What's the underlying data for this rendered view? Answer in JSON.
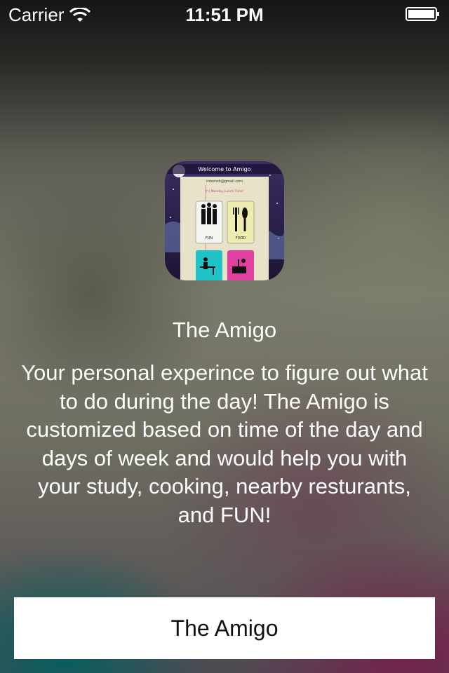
{
  "status_bar": {
    "carrier": "Carrier",
    "time": "11:51 PM",
    "icons": [
      "wifi-icon",
      "battery-icon"
    ]
  },
  "app_icon": {
    "header_text": "Welcome to Amigo",
    "email_text": "misonsh@gmail.com",
    "subtext": "It's Monday Lunch Time!",
    "tiles": [
      "FUN",
      "FOOD",
      "study",
      "cooking"
    ]
  },
  "main": {
    "title": "The Amigo",
    "description": "Your personal experince to figure out what to do during the day! The Amigo is customized based on time of the day and days of week and would help you with your study, cooking, nearby resturants, and FUN!"
  },
  "button": {
    "label": "The Amigo"
  },
  "colors": {
    "button_background": "#ffffff",
    "button_text": "#111111",
    "text": "#ffffff"
  }
}
